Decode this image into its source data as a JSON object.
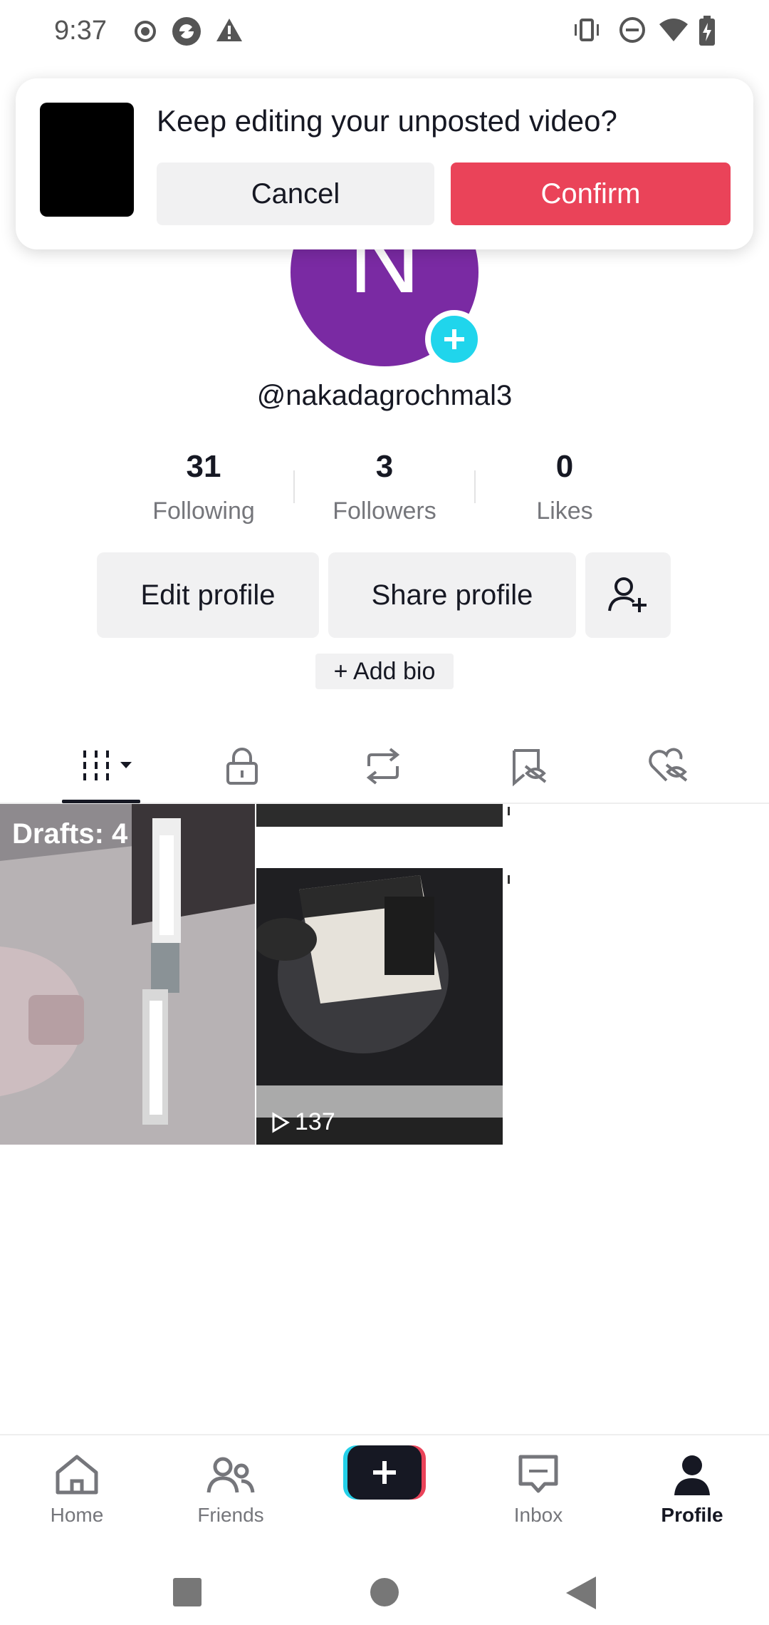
{
  "status_bar": {
    "time": "9:37"
  },
  "dialog": {
    "title": "Keep editing your unposted video?",
    "cancel_label": "Cancel",
    "confirm_label": "Confirm"
  },
  "profile": {
    "avatar_letter": "N",
    "username": "@nakadagrochmal3",
    "stats": [
      {
        "value": "31",
        "label": "Following"
      },
      {
        "value": "3",
        "label": "Followers"
      },
      {
        "value": "0",
        "label": "Likes"
      }
    ],
    "edit_profile_label": "Edit profile",
    "share_profile_label": "Share profile",
    "add_bio_label": "+ Add bio"
  },
  "tabs": [
    {
      "name": "videos",
      "icon": "grid-icon",
      "selected": true
    },
    {
      "name": "private",
      "icon": "lock-icon"
    },
    {
      "name": "reposts",
      "icon": "repost-icon"
    },
    {
      "name": "favorites",
      "icon": "bookmark-hidden-icon"
    },
    {
      "name": "liked",
      "icon": "heart-hidden-icon"
    }
  ],
  "grid": {
    "drafts_label": "Drafts: 4",
    "video_views": "137"
  },
  "bottom_nav": {
    "home": "Home",
    "friends": "Friends",
    "inbox": "Inbox",
    "profile": "Profile"
  },
  "colors": {
    "accent": "#ea4359",
    "avatar": "#7a2aa3",
    "avatar_add": "#20d5ec"
  }
}
